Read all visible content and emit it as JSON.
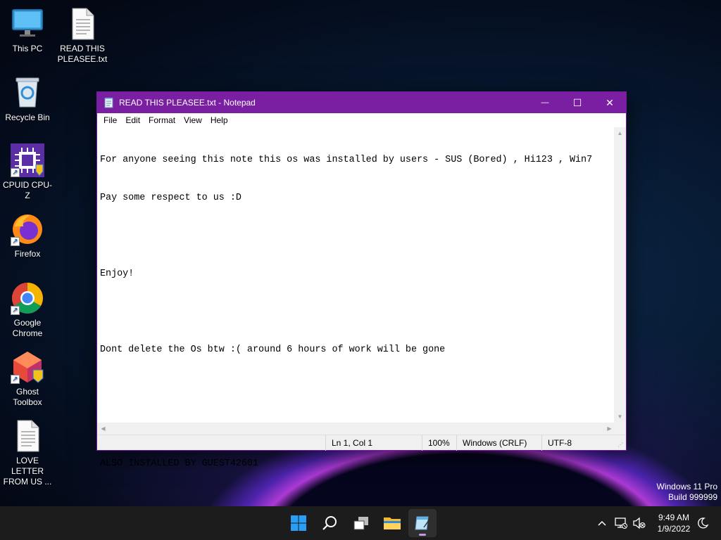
{
  "desktop": {
    "icons": [
      {
        "label": "This PC"
      },
      {
        "label": "READ THIS PLEASEE.txt"
      },
      {
        "label": "Recycle Bin"
      },
      {
        "label": "CPUID CPU-Z"
      },
      {
        "label": "Firefox"
      },
      {
        "label": "Google Chrome"
      },
      {
        "label": "Ghost Toolbox"
      },
      {
        "label": "LOVE LETTER FROM US ..."
      }
    ]
  },
  "window": {
    "title": "READ THIS PLEASEE.txt - Notepad",
    "controls": {
      "minimize": "—",
      "maximize": "☐",
      "close": "✕"
    },
    "menu": [
      "File",
      "Edit",
      "Format",
      "View",
      "Help"
    ],
    "content_lines": [
      "For anyone seeing this note this os was installed by users - SUS (Bored) , Hi123 , Win7",
      "Pay some respect to us :D",
      "",
      "Enjoy!",
      "",
      "Dont delete the Os btw :( around 6 hours of work will be gone",
      "",
      "",
      "ALSO INSTALLED BY GUEST42601"
    ],
    "status": {
      "position": "Ln 1, Col 1",
      "zoom": "100%",
      "line_ending": "Windows (CRLF)",
      "encoding": "UTF-8"
    }
  },
  "watermark": {
    "line1": "Windows 11 Pro",
    "line2": "Build 999999"
  },
  "taskbar": {
    "apps": [
      "start-icon",
      "search-icon",
      "task-view-icon",
      "file-explorer-icon",
      "notepad-icon"
    ],
    "tray": [
      "chevron-up-icon",
      "network-icon",
      "volume-muted-icon",
      "focus-assist-icon"
    ],
    "clock": {
      "time": "9:49 AM",
      "date": "1/9/2022"
    }
  },
  "colors": {
    "titlebar": "#7b1fa2",
    "taskbar": "#1c1c1c",
    "accent_indicator": "#c39ade"
  }
}
